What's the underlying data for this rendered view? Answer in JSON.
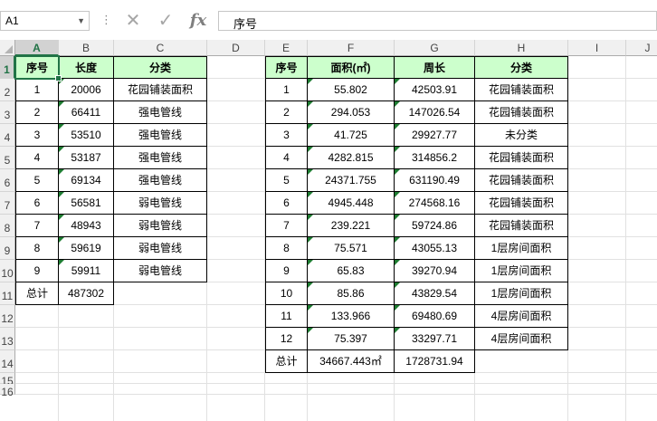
{
  "name_box": "A1",
  "formula_value": "序号",
  "formula_buttons": {
    "cancel": "✕",
    "enter": "✓",
    "fx": "fx"
  },
  "columns": [
    "A",
    "B",
    "C",
    "D",
    "E",
    "F",
    "G",
    "H",
    "I",
    "J"
  ],
  "rows": [
    "1",
    "2",
    "3",
    "4",
    "5",
    "6",
    "7",
    "8",
    "9",
    "10",
    "11",
    "12",
    "13",
    "14",
    "15",
    "16"
  ],
  "left_table": {
    "headers": [
      "序号",
      "长度",
      "分类"
    ],
    "rows": [
      [
        "1",
        "20006",
        "花园铺装面积"
      ],
      [
        "2",
        "66411",
        "强电管线"
      ],
      [
        "3",
        "53510",
        "强电管线"
      ],
      [
        "4",
        "53187",
        "强电管线"
      ],
      [
        "5",
        "69134",
        "强电管线"
      ],
      [
        "6",
        "56581",
        "弱电管线"
      ],
      [
        "7",
        "48943",
        "弱电管线"
      ],
      [
        "8",
        "59619",
        "弱电管线"
      ],
      [
        "9",
        "59911",
        "弱电管线"
      ]
    ],
    "total_label": "总计",
    "total_value": "487302"
  },
  "right_table": {
    "headers": [
      "序号",
      "面积(㎡)",
      "周长",
      "分类"
    ],
    "rows": [
      [
        "1",
        "55.802",
        "42503.91",
        "花园铺装面积"
      ],
      [
        "2",
        "294.053",
        "147026.54",
        "花园铺装面积"
      ],
      [
        "3",
        "41.725",
        "29927.77",
        "未分类"
      ],
      [
        "4",
        "4282.815",
        "314856.2",
        "花园铺装面积"
      ],
      [
        "5",
        "24371.755",
        "631190.49",
        "花园铺装面积"
      ],
      [
        "6",
        "4945.448",
        "274568.16",
        "花园铺装面积"
      ],
      [
        "7",
        "239.221",
        "59724.86",
        "花园铺装面积"
      ],
      [
        "8",
        "75.571",
        "43055.13",
        "1层房间面积"
      ],
      [
        "9",
        "65.83",
        "39270.94",
        "1层房间面积"
      ],
      [
        "10",
        "85.86",
        "43829.54",
        "1层房间面积"
      ],
      [
        "11",
        "133.966",
        "69480.69",
        "4层房间面积"
      ],
      [
        "12",
        "75.397",
        "33297.71",
        "4层房间面积"
      ]
    ],
    "total_label": "总计",
    "total_area": "34667.443㎡",
    "total_perimeter": "1728731.94"
  },
  "colors": {
    "header_fill": "#ccffcc",
    "selection": "#217346",
    "marker": "#1e7d32"
  }
}
